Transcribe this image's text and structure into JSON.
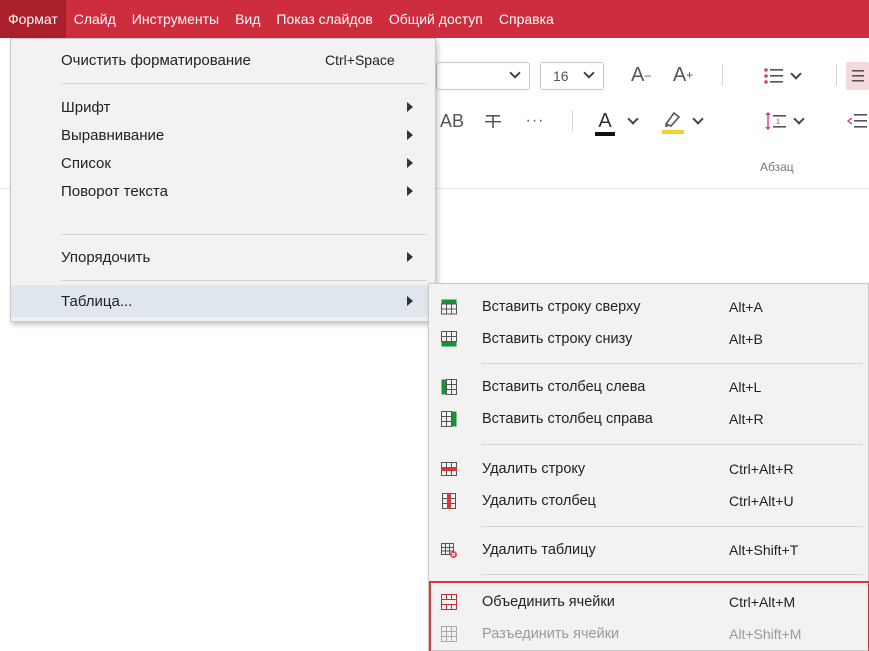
{
  "menubar": {
    "items": [
      {
        "label": "Формат",
        "active": true
      },
      {
        "label": "Слайд"
      },
      {
        "label": "Инструменты"
      },
      {
        "label": "Вид"
      },
      {
        "label": "Показ слайдов"
      },
      {
        "label": "Общий доступ"
      },
      {
        "label": "Справка"
      }
    ],
    "color": "#cd2d3c"
  },
  "ribbon": {
    "font_size": "16",
    "grow_font_label": "A",
    "shrink_font_label": "A",
    "grow_sup": "+",
    "shrink_sup": "–",
    "ab_label": "AB",
    "more_label": "···",
    "font_color_label": "A",
    "paragraph_group_label": "Абзац"
  },
  "format_menu": {
    "clear_formatting": {
      "label": "Очистить форматирование",
      "shortcut": "Ctrl+Space"
    },
    "font": {
      "label": "Шрифт"
    },
    "alignment": {
      "label": "Выравнивание"
    },
    "list": {
      "label": "Список"
    },
    "text_rotation": {
      "label": "Поворот текста"
    },
    "arrange": {
      "label": "Упорядочить"
    },
    "table": {
      "label": "Таблица..."
    }
  },
  "table_menu": {
    "insert_row_above": {
      "label": "Вставить строку сверху",
      "shortcut": "Alt+A",
      "icon": "insert-row-above-icon"
    },
    "insert_row_below": {
      "label": "Вставить строку снизу",
      "shortcut": "Alt+B",
      "icon": "insert-row-below-icon"
    },
    "insert_col_left": {
      "label": "Вставить столбец слева",
      "shortcut": "Alt+L",
      "icon": "insert-column-left-icon"
    },
    "insert_col_right": {
      "label": "Вставить столбец справа",
      "shortcut": "Alt+R",
      "icon": "insert-column-right-icon"
    },
    "delete_row": {
      "label": "Удалить строку",
      "shortcut": "Ctrl+Alt+R",
      "icon": "delete-row-icon"
    },
    "delete_column": {
      "label": "Удалить столбец",
      "shortcut": "Ctrl+Alt+U",
      "icon": "delete-column-icon"
    },
    "delete_table": {
      "label": "Удалить таблицу",
      "shortcut": "Alt+Shift+T",
      "icon": "delete-table-icon"
    },
    "merge_cells": {
      "label": "Объединить ячейки",
      "shortcut": "Ctrl+Alt+M",
      "icon": "merge-cells-icon"
    },
    "split_cells": {
      "label": "Разъединить ячейки",
      "shortcut": "Alt+Shift+M",
      "icon": "split-cells-icon",
      "disabled": true
    }
  },
  "colors": {
    "accent": "#cd2d3c",
    "highlight_box": "#d23a3a",
    "menu_bg": "#f2f2f2",
    "green_icon": "#1a8f3a"
  }
}
